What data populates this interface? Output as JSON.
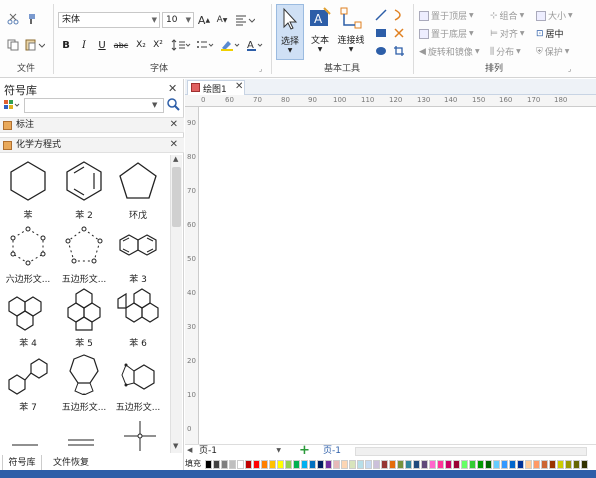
{
  "ribbon": {
    "groups": {
      "file": "文件",
      "font": "字体",
      "basic_tools": "基本工具",
      "arrange": "排列"
    },
    "font_name": "宋体",
    "font_size": "10",
    "font_buttons": [
      "B",
      "I",
      "U",
      "abc",
      "X₂",
      "X²"
    ],
    "tools": {
      "select": "选择",
      "text": "文本",
      "connector": "连接线"
    },
    "arrange_items": {
      "bring_front": "置于顶层",
      "send_back": "置于底层",
      "rotate_mirror": "旋转和镜像",
      "group": "组合",
      "align": "对齐",
      "distribute": "分布",
      "size": "大小",
      "center": "居中",
      "protect": "保护"
    }
  },
  "library": {
    "title": "符号库",
    "search_placeholder": "",
    "sections": {
      "annotation": "标注",
      "chem": "化学方程式"
    },
    "shapes": [
      {
        "label": "苯"
      },
      {
        "label": "苯 2"
      },
      {
        "label": "环戊"
      },
      {
        "label": "六边形文..."
      },
      {
        "label": "五边形文..."
      },
      {
        "label": "苯 3"
      },
      {
        "label": "苯 4"
      },
      {
        "label": "苯 5"
      },
      {
        "label": "苯 6"
      },
      {
        "label": "苯 7"
      },
      {
        "label": "五边形文..."
      },
      {
        "label": "五边形文..."
      }
    ],
    "bottom_tabs": {
      "symbols": "符号库",
      "file_recovery": "文件恢复"
    }
  },
  "document": {
    "tab_title": "绘图1",
    "ruler_h": [
      "0",
      "60",
      "70",
      "80",
      "90",
      "100",
      "110",
      "120",
      "130",
      "140",
      "150",
      "160",
      "170",
      "180"
    ],
    "ruler_v": [
      "90",
      "80",
      "70",
      "60",
      "50",
      "40",
      "30",
      "20",
      "10",
      "0"
    ],
    "page_select": "页-1",
    "page_tab": "页-1",
    "fill_label": "填充"
  },
  "colors": {
    "accent": "#2d5ea8",
    "ribbon_bg": "#fdfdfd",
    "palette": [
      "#000000",
      "#404040",
      "#7f7f7f",
      "#bfbfbf",
      "#ffffff",
      "#c00000",
      "#ff0000",
      "#ff7f00",
      "#ffc000",
      "#ffff00",
      "#92d050",
      "#00b050",
      "#00b0f0",
      "#0070c0",
      "#002060",
      "#7030a0",
      "#e6b9b8",
      "#fcd5b4",
      "#d8e4bc",
      "#b7dee8",
      "#c5d9f1",
      "#ccc0da",
      "#953734",
      "#e46c0a",
      "#76923c",
      "#31859c",
      "#1f497d",
      "#5f497a",
      "#ff66cc",
      "#ff3399",
      "#cc0066",
      "#990033",
      "#66ff66",
      "#33cc33",
      "#009900",
      "#006600",
      "#66ccff",
      "#3399ff",
      "#0066cc",
      "#003399",
      "#ffcc99",
      "#ff9966",
      "#cc6633",
      "#993300",
      "#cccc00",
      "#999900",
      "#666600",
      "#333300"
    ]
  }
}
